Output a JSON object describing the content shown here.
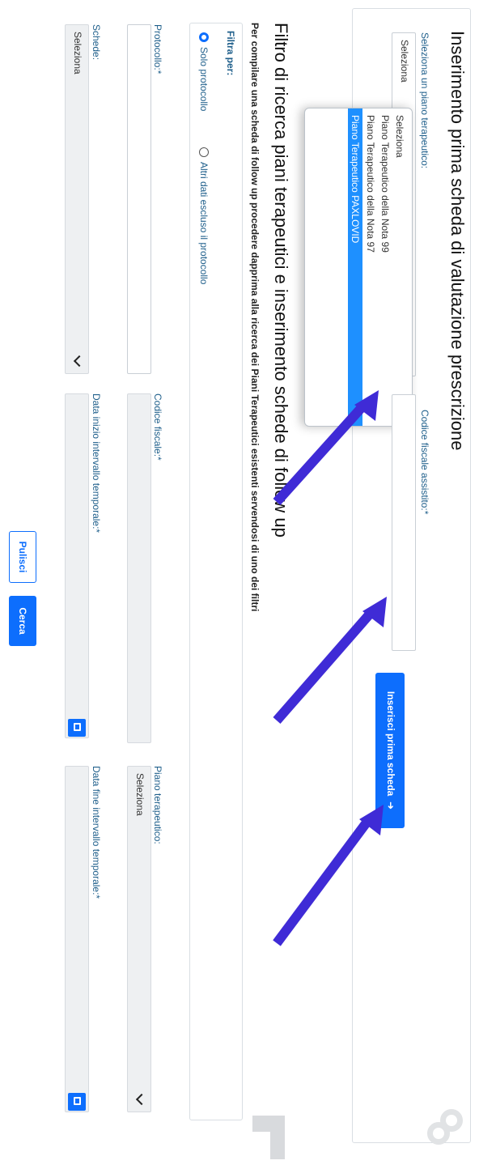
{
  "insert_section": {
    "title": "Inserimento prima scheda di valutazione prescrizione",
    "select_label": "Seleziona un piano terapeutico:",
    "select_value": "Seleziona",
    "dropdown_options": [
      "Seleziona",
      "Piano Terapeutico della Nota 99",
      "Piano Terapeutico della Nota 97",
      "Piano Terapeutico PAXLOVID"
    ],
    "selected_option_index": 3,
    "codice_label": "Codice fiscale assistito:*",
    "codice_value": "",
    "insert_button": "Inserisci prima scheda",
    "insert_button_icon": "arrow-right-icon"
  },
  "search_section": {
    "title": "Filtro di ricerca piani terapeutici e inserimento schede di follow up",
    "instructions": "Per compilare una scheda di follow up procedere dapprima alla ricerca dei Piani Terapeutici esistenti servendosi di uno dei filtri",
    "filter_label": "Filtra per:",
    "radio_protocol": "Solo protocollo",
    "radio_other": "Altri dati escluso il protocollo",
    "radio_selected": "Solo protocollo",
    "protocollo_label": "Protocollo:*",
    "codice_label": "Codice fiscale:*",
    "piano_label": "Piano terapeutico:",
    "piano_value": "Seleziona",
    "schede_label": "Schede:",
    "schede_value": "Seleziona",
    "data_inizio_label": "Data inizio intervallo temporale:*",
    "data_fine_label": "Data fine intervallo temporale:*",
    "pulisci_button": "Pulisci",
    "cerca_button": "Cerca"
  },
  "colors": {
    "primary": "#0d6efd",
    "arrow": "#3f2bd6",
    "selected_option": "#1e90ff"
  }
}
